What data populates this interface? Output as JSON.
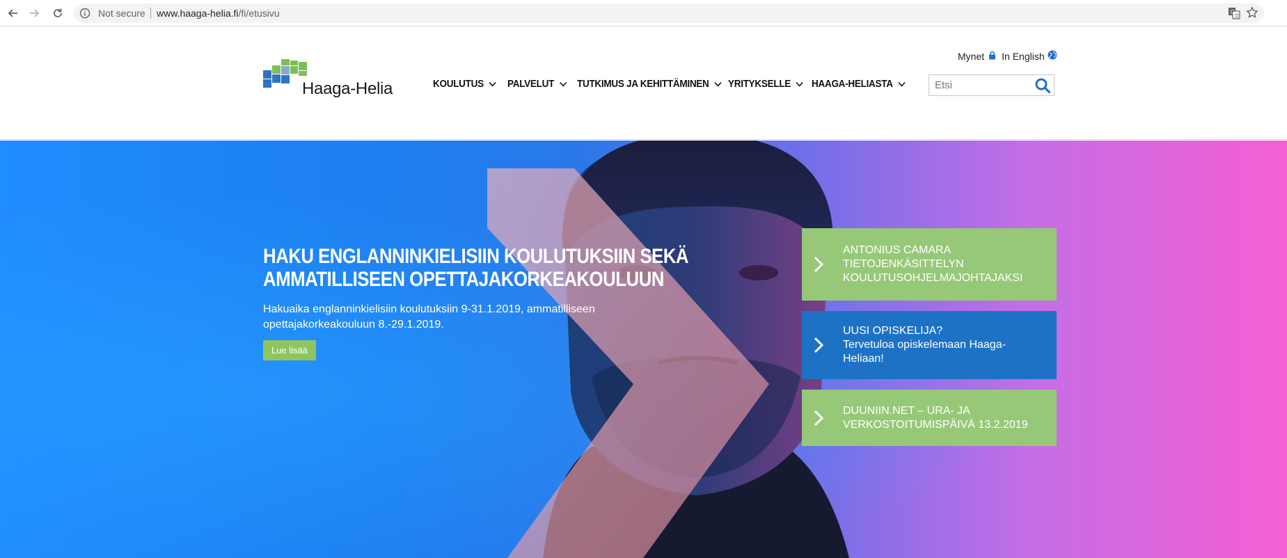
{
  "browser": {
    "security_label": "Not secure",
    "url_host": "www.haaga-helia.fi",
    "url_path": "/fi/etusivu",
    "icons": [
      "back-icon",
      "forward-icon",
      "reload-icon",
      "info-icon",
      "translate-icon",
      "star-icon"
    ]
  },
  "header": {
    "logo_text": "Haaga-Helia",
    "util": {
      "mynet_label": "Mynet",
      "english_label": "In English"
    },
    "nav": [
      {
        "label": "KOULUTUS"
      },
      {
        "label": "PALVELUT"
      },
      {
        "label": "TUTKIMUS JA KEHITTÄMINEN"
      },
      {
        "label": "YRITYKSELLE"
      },
      {
        "label": "HAAGA-HELIASTA"
      }
    ],
    "search": {
      "placeholder": "Etsi",
      "value": ""
    }
  },
  "hero": {
    "title_line1": "HAKU ENGLANNINKIELISIIN KOULUTUKSIIN SEKÄ",
    "title_line2": "AMMATILLISEEN OPETTAJAKORKEAKOULUUN",
    "desc_line1": "Hakuaika englanninkielisiin koulutuksiin 9-31.1.2019, ammatilliseen",
    "desc_line2": "opettajakorkeakouluun 8.-29.1.2019.",
    "button_label": "Lue lisää"
  },
  "cards": [
    {
      "line1": "ANTONIUS CAMARA",
      "line2": "TIETOJENKÄSITTELYN",
      "line3": "KOULUTUSOHJELMAJOHTAJAKSI"
    },
    {
      "line1": "UUSI OPISKELIJA?",
      "line2": "Tervetuloa opiskelemaan Haaga-",
      "line3": "Heliaan!"
    },
    {
      "line1": "DUUNIIN.NET – URA- JA",
      "line2": "VERKOSTOITUMISPÄIVÄ 13.2.2019"
    }
  ],
  "colors": {
    "accent_green": "#97c878",
    "accent_blue": "#1d72c6",
    "logo_blue": "#2f74c0",
    "logo_green": "#7bbf57"
  }
}
